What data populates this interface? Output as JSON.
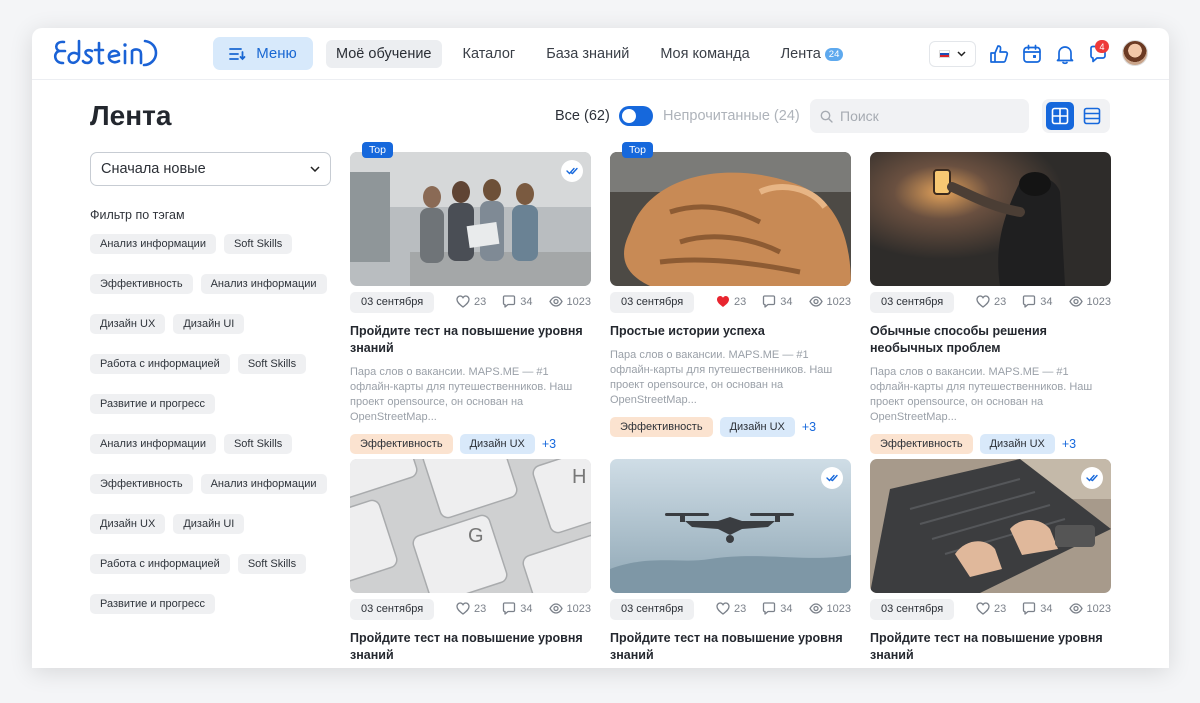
{
  "header": {
    "menu_label": "Меню",
    "nav": [
      {
        "label": "Моё обучение",
        "active": true
      },
      {
        "label": "Каталог",
        "active": false
      },
      {
        "label": "База знаний",
        "active": false
      },
      {
        "label": "Моя команда",
        "active": false
      },
      {
        "label": "Лента",
        "active": false,
        "badge": "24"
      }
    ],
    "messages_badge": "4",
    "colors": {
      "accent": "#1668dc",
      "badge": "#ee3b3b"
    },
    "icons": [
      "menu-icon",
      "flag-ru-icon",
      "chevron-down-icon",
      "like-icon",
      "calendar-icon",
      "bell-icon",
      "chat-icon",
      "avatar"
    ]
  },
  "page": {
    "title": "Лента",
    "all_label": "Все (62)",
    "unread_label": "Непрочитанные (24)",
    "search_placeholder": "Поиск",
    "sort_value": "Сначала новые",
    "filter_title": "Фильтр по тэгам",
    "tags": [
      "Анализ информации",
      "Soft Skills",
      "Эффективность",
      "Анализ информации",
      "Дизайн UX",
      "Дизайн UI",
      "Работа с информацией",
      "Soft Skills",
      "Развитие и прогресс",
      "Анализ информации",
      "Soft Skills",
      "Эффективность",
      "Анализ информации",
      "Дизайн UX",
      "Дизайн UI",
      "Работа с информацией",
      "Soft Skills",
      "Развитие и прогресс"
    ]
  },
  "cards": [
    {
      "top": "Top",
      "read": true,
      "liked": false,
      "date": "03 сентября",
      "likes": "23",
      "comments": "34",
      "views": "1023",
      "title": "Пройдите тест на повышение уровня знаний",
      "desc": "Пара слов о вакансии. MAPS.ME — #1 офлайн-карты для путешественников. Наш проект opensource, он основан на OpenStreetMap...",
      "tag1": "Эффективность",
      "tag2": "Дизайн UX",
      "more": "+3"
    },
    {
      "top": "Top",
      "read": false,
      "liked": true,
      "date": "03 сентября",
      "likes": "23",
      "comments": "34",
      "views": "1023",
      "title": "Простые истории успеха",
      "desc": "Пара слов о вакансии. MAPS.ME — #1 офлайн-карты для путешественников. Наш проект opensource, он основан на OpenStreetMap...",
      "tag1": "Эффективность",
      "tag2": "Дизайн UX",
      "more": "+3"
    },
    {
      "top": "",
      "read": false,
      "liked": false,
      "date": "03 сентября",
      "likes": "23",
      "comments": "34",
      "views": "1023",
      "title": "Обычные способы решения необычных проблем",
      "desc": "Пара слов о вакансии. MAPS.ME — #1 офлайн-карты для путешественников. Наш проект opensource, он основан на OpenStreetMap...",
      "tag1": "Эффективность",
      "tag2": "Дизайн UX",
      "more": "+3"
    },
    {
      "top": "",
      "read": false,
      "liked": false,
      "date": "03 сентября",
      "likes": "23",
      "comments": "34",
      "views": "1023",
      "title": "Пройдите тест на повышение уровня знаний"
    },
    {
      "top": "",
      "read": true,
      "liked": false,
      "date": "03 сентября",
      "likes": "23",
      "comments": "34",
      "views": "1023",
      "title": "Пройдите тест на повышение уровня знаний"
    },
    {
      "top": "",
      "read": true,
      "liked": false,
      "date": "03 сентября",
      "likes": "23",
      "comments": "34",
      "views": "1023",
      "title": "Пройдите тест на повышение уровня знаний"
    }
  ]
}
